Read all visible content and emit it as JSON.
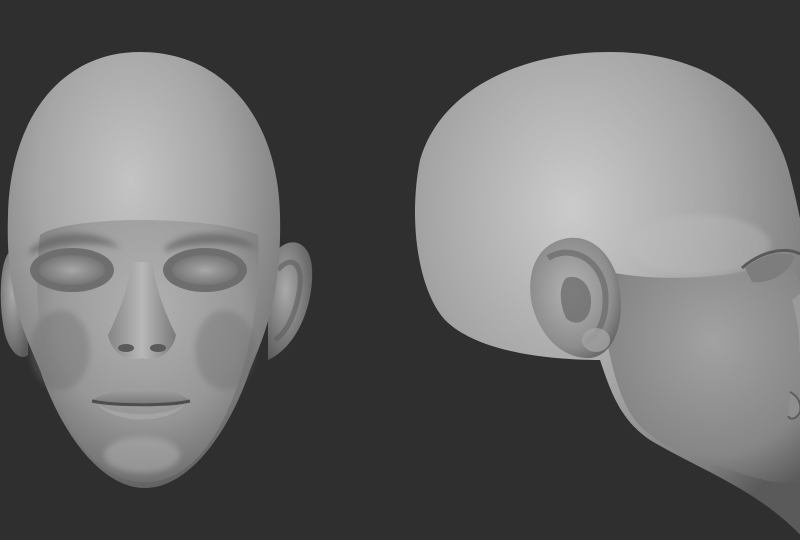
{
  "scene": {
    "background_color": "#2f2f2f",
    "clay_base_color": "#9a9a9a",
    "clay_highlight_color": "#c9c9c9",
    "clay_shadow_color": "#4a4a4a",
    "views": [
      "front",
      "side"
    ]
  }
}
